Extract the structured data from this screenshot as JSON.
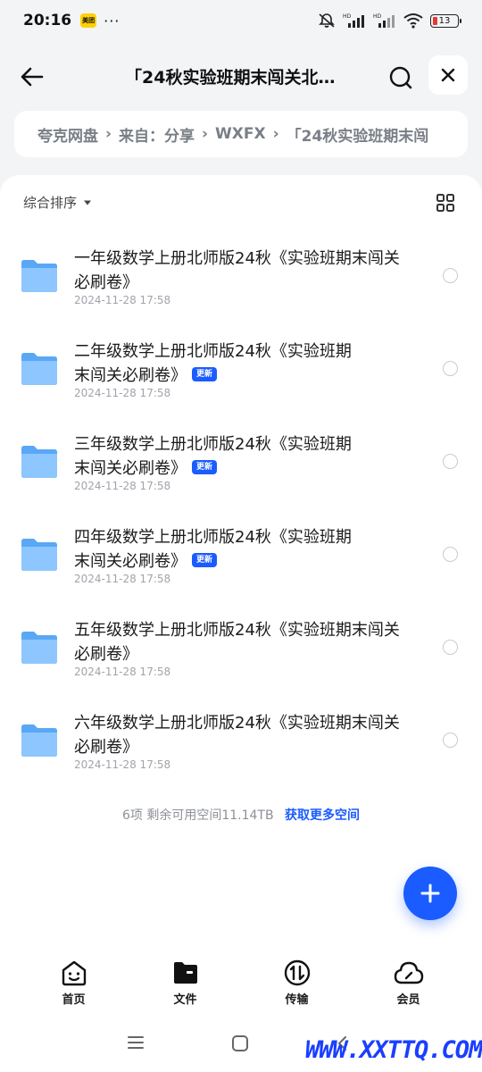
{
  "status_bar": {
    "time": "20:16",
    "app_badge": "美团",
    "more": "···",
    "battery": "13",
    "signal_label_1": "HD",
    "signal_label_2": "HD"
  },
  "header": {
    "title": "「24秋实验班期末闯关北…"
  },
  "breadcrumb": {
    "items": [
      "夸克网盘",
      "来自：分享",
      "WXFX",
      "「24秋实验班期末闯"
    ]
  },
  "sort": {
    "label": "综合排序"
  },
  "files": [
    {
      "title": "一年级数学上册北师版24秋《实验班期末闯关必刷卷》",
      "date": "2024-11-28 17:58",
      "badge": ""
    },
    {
      "title": "二年级数学上册北师版24秋《实验班期末闯关必刷卷》",
      "date": "2024-11-28 17:58",
      "badge": "更新"
    },
    {
      "title": "三年级数学上册北师版24秋《实验班期末闯关必刷卷》",
      "date": "2024-11-28 17:58",
      "badge": "更新"
    },
    {
      "title": "四年级数学上册北师版24秋《实验班期末闯关必刷卷》",
      "date": "2024-11-28 17:58",
      "badge": "更新"
    },
    {
      "title": "五年级数学上册北师版24秋《实验班期末闯关必刷卷》",
      "date": "2024-11-28 17:58",
      "badge": ""
    },
    {
      "title": "六年级数学上册北师版24秋《实验班期末闯关必刷卷》",
      "date": "2024-11-28 17:58",
      "badge": ""
    }
  ],
  "footer": {
    "summary": "6项 剩余可用空间11.14TB",
    "link": "获取更多空间"
  },
  "nav": {
    "items": [
      {
        "label": "首页",
        "icon": "smile-home-icon"
      },
      {
        "label": "文件",
        "icon": "folder-icon"
      },
      {
        "label": "传输",
        "icon": "transfer-icon"
      },
      {
        "label": "会员",
        "icon": "cloud-member-icon"
      }
    ]
  },
  "watermark": "WWW.XXTTQ.COM",
  "colors": {
    "accent": "#1a5cff",
    "background": "#f3f4f6",
    "folder": "#5aa8f5"
  }
}
